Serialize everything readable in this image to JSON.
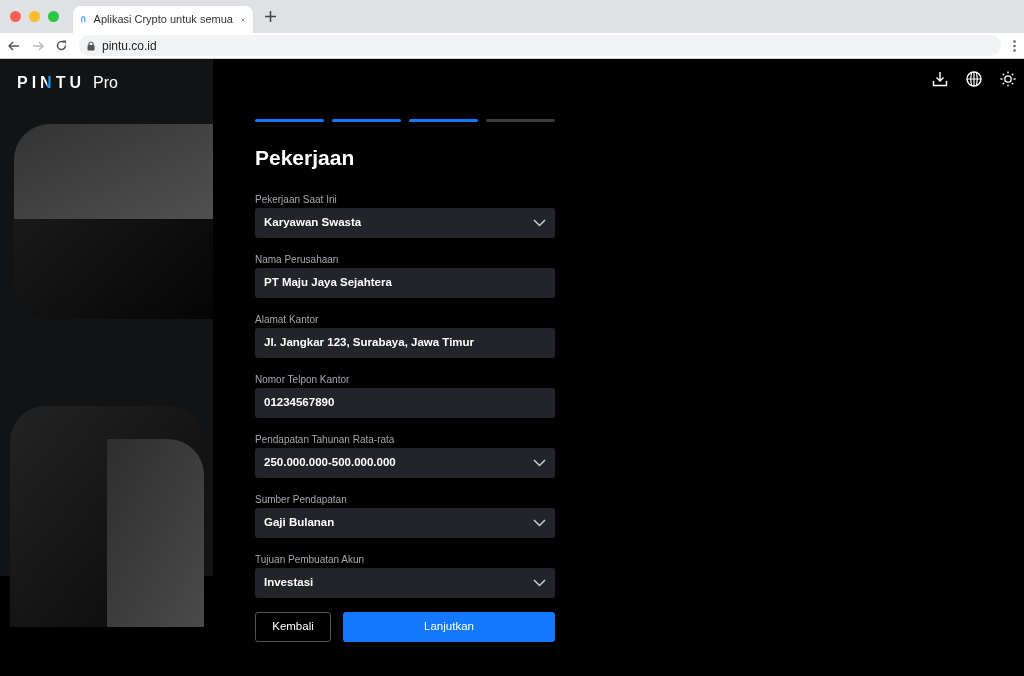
{
  "browser": {
    "tab_title": "Aplikasi Crypto untuk semua",
    "address": "pintu.co.id"
  },
  "header": {
    "wordmark": "PINTU",
    "suffix": "Pro"
  },
  "steps": [
    {
      "done": true
    },
    {
      "done": true
    },
    {
      "done": true
    },
    {
      "done": false
    }
  ],
  "title": "Pekerjaan",
  "fields": [
    {
      "kind": "select",
      "label": "Pekerjaan Saat Ini",
      "value": "Karyawan Swasta"
    },
    {
      "kind": "text",
      "label": "Nama Perusahaan",
      "value": "PT Maju Jaya Sejahtera"
    },
    {
      "kind": "text",
      "label": "Alamat Kantor",
      "value": "Jl. Jangkar 123, Surabaya, Jawa Timur"
    },
    {
      "kind": "text",
      "label": "Nomor Telpon Kantor",
      "value": "01234567890"
    },
    {
      "kind": "select",
      "label": "Pendapatan Tahunan Rata-rata",
      "value": "250.000.000-500.000.000"
    },
    {
      "kind": "select",
      "label": "Sumber Pendapatan",
      "value": "Gaji Bulanan"
    },
    {
      "kind": "select",
      "label": "Tujuan Pembuatan Akun",
      "value": "Investasi"
    }
  ],
  "buttons": {
    "back": "Kembali",
    "next": "Lanjutkan"
  }
}
